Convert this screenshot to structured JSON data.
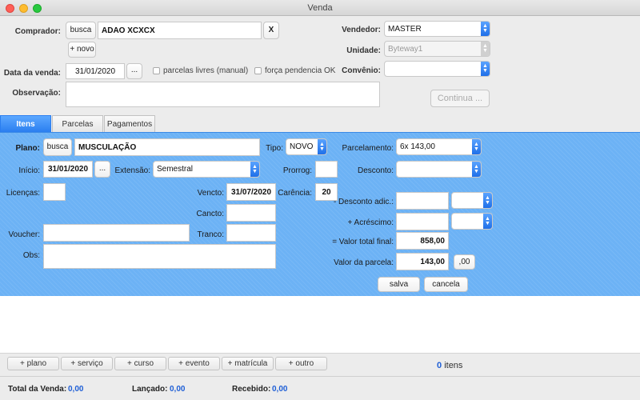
{
  "window": {
    "title": "Venda"
  },
  "header": {
    "comprador_label": "Comprador:",
    "busca_label": "busca",
    "comprador_value": "ADAO XCXCX",
    "clear_label": "X",
    "novo_label": "+ novo",
    "vendedor_label": "Vendedor:",
    "vendedor_value": "MASTER",
    "unidade_label": "Unidade:",
    "unidade_value": "Byteway1",
    "data_label": "Data da venda:",
    "data_value": "31/01/2020",
    "date_picker_label": "...",
    "parcelas_livres_label": "parcelas livres (manual)",
    "forca_pendencia_label": "força pendencia OK",
    "convenio_label": "Convênio:",
    "convenio_value": "",
    "observacao_label": "Observação:",
    "observacao_value": "",
    "continua_label": "Continua ..."
  },
  "tabs": [
    {
      "label": "Itens",
      "active": true
    },
    {
      "label": "Parcelas",
      "active": false
    },
    {
      "label": "Pagamentos",
      "active": false
    }
  ],
  "item": {
    "plano_label": "Plano:",
    "busca_label": "busca",
    "plano_value": "MUSCULAÇÃO",
    "tipo_label": "Tipo:",
    "tipo_value": "NOVO",
    "parcelamento_label": "Parcelamento:",
    "parcelamento_value": "6x 143,00",
    "inicio_label": "Início:",
    "inicio_value": "31/01/2020",
    "inicio_picker_label": "...",
    "extensao_label": "Extensão:",
    "extensao_value": "Semestral",
    "prorrog_label": "Prorrog:",
    "prorrog_value": "",
    "desconto_label": "Desconto:",
    "desconto_value": "",
    "licencas_label": "Licenças:",
    "licencas_value": "",
    "vencto_label": "Vencto:",
    "vencto_value": "31/07/2020",
    "carencia_label": "Carência:",
    "carencia_value": "20",
    "desconto_adic_label": "- Desconto adic.:",
    "desconto_adic_value": "",
    "cancto_label": "Cancto:",
    "cancto_value": "",
    "acrescimo_label": "+ Acréscimo:",
    "acrescimo_value": "",
    "voucher_label": "Voucher:",
    "voucher_value": "",
    "tranco_label": "Tranco:",
    "tranco_value": "",
    "valor_total_label": "= Valor total final:",
    "valor_total_value": "858,00",
    "obs_label": "Obs:",
    "obs_value": "",
    "valor_parcela_label": "Valor da parcela:",
    "valor_parcela_value": "143,00",
    "cents_label": ",00",
    "salva_label": "salva",
    "cancela_label": "cancela"
  },
  "bottom_buttons": [
    "+ plano",
    "+ serviço",
    "+ curso",
    "+ evento",
    "+ matrícula",
    "+ outro"
  ],
  "items_count": {
    "value": "0",
    "label": "itens"
  },
  "footer": {
    "total_label": "Total da Venda:",
    "total_value": "0,00",
    "lancado_label": "Lançado:",
    "lancado_value": "0,00",
    "recebido_label": "Recebido:",
    "recebido_value": "0,00"
  },
  "colors": {
    "accent": "#2a7ef0",
    "panel": "#6cb2f5",
    "value_blue": "#1f5fd6",
    "close": "#fe5f57",
    "minimize": "#febc2e",
    "zoom": "#28c840"
  }
}
